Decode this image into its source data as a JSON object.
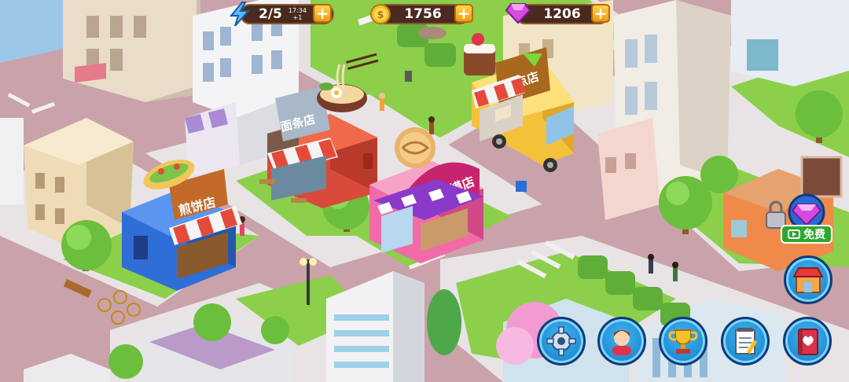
{
  "hud": {
    "energy": {
      "value": "2/5",
      "timer": "17:34",
      "regen": "+1",
      "icon": "lightning-icon"
    },
    "coins": {
      "value": "1756",
      "icon": "coin-icon"
    },
    "gems": {
      "value": "1206",
      "icon": "gem-icon"
    },
    "plus_label": "+"
  },
  "shops": {
    "noodle": {
      "name": "面条店"
    },
    "pancake": {
      "name": "煎饼店"
    },
    "roujiamo": {
      "name": "肉夹馍店"
    },
    "pastry": {
      "name": "糕点店"
    }
  },
  "reward": {
    "free_label": "免费",
    "icon": "video-icon"
  },
  "buttons": [
    "settings",
    "friends",
    "trophy",
    "tasks",
    "recipe-book",
    "shop"
  ],
  "colors": {
    "grass": "#8ccf4a",
    "road": "#c79ea5",
    "sidewalk": "#e8e4e6",
    "accent": "#f29a12",
    "button_blue": "#1f8ee0"
  }
}
